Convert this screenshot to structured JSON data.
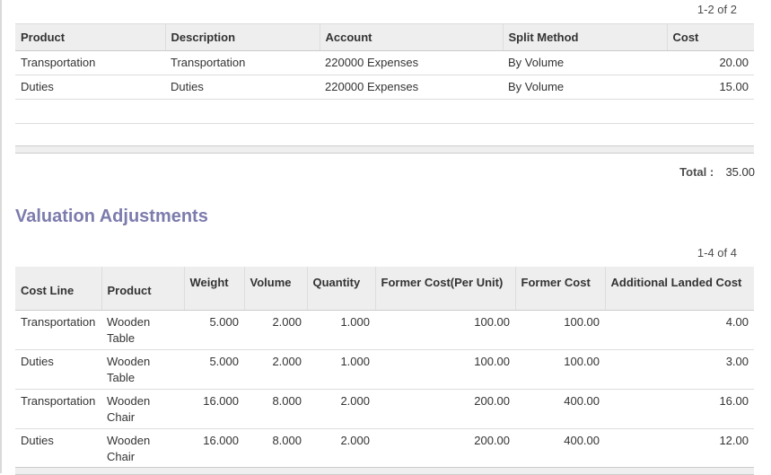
{
  "cost_lines": {
    "pager": "1-2 of 2",
    "columns": [
      "Product",
      "Description",
      "Account",
      "Split Method",
      "Cost"
    ],
    "rows": [
      {
        "product": "Transportation",
        "description": "Transportation",
        "account": "220000 Expenses",
        "split_method": "By Volume",
        "cost": "20.00"
      },
      {
        "product": "Duties",
        "description": "Duties",
        "account": "220000 Expenses",
        "split_method": "By Volume",
        "cost": "15.00"
      }
    ],
    "total_label": "Total :",
    "total_value": "35.00"
  },
  "valuation": {
    "title": "Valuation Adjustments",
    "pager": "1-4 of 4",
    "columns": [
      "Cost Line",
      "Product",
      "Weight",
      "Volume",
      "Quantity",
      "Former Cost(Per Unit)",
      "Former Cost",
      "Additional Landed Cost"
    ],
    "rows": [
      {
        "cost_line": "Transportation",
        "product": "Wooden Table",
        "weight": "5.000",
        "volume": "2.000",
        "quantity": "1.000",
        "former_unit": "100.00",
        "former_cost": "100.00",
        "additional": "4.00"
      },
      {
        "cost_line": "Duties",
        "product": "Wooden Table",
        "weight": "5.000",
        "volume": "2.000",
        "quantity": "1.000",
        "former_unit": "100.00",
        "former_cost": "100.00",
        "additional": "3.00"
      },
      {
        "cost_line": "Transportation",
        "product": "Wooden Chair",
        "weight": "16.000",
        "volume": "8.000",
        "quantity": "2.000",
        "former_unit": "200.00",
        "former_cost": "400.00",
        "additional": "16.00"
      },
      {
        "cost_line": "Duties",
        "product": "Wooden Chair",
        "weight": "16.000",
        "volume": "8.000",
        "quantity": "2.000",
        "former_unit": "200.00",
        "former_cost": "400.00",
        "additional": "12.00"
      }
    ]
  }
}
